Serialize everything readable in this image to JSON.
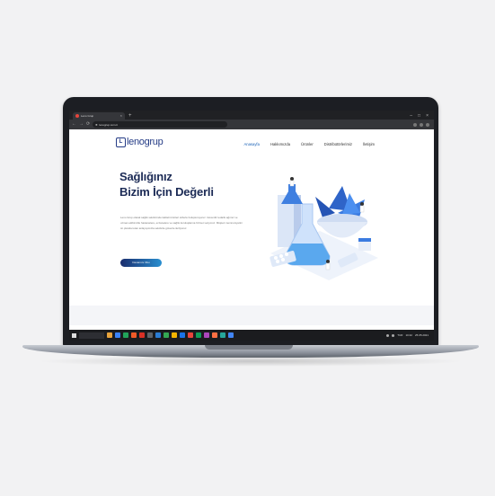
{
  "browser": {
    "tab_title": "Leno Grup",
    "url": "lenogrup.com.tr",
    "new_tab_glyph": "+",
    "close_glyph": "×",
    "window_controls": [
      "–",
      "□",
      "×"
    ],
    "nav_glyphs": [
      "←",
      "→",
      "⟳"
    ]
  },
  "site": {
    "logo_text": "lenogrup",
    "logo_mark": "L",
    "brand_color": "#253c86",
    "accent_color": "#2a8fd0",
    "menu": [
      {
        "label": "Anasayfa",
        "active": true
      },
      {
        "label": "Hakkımızda",
        "active": false
      },
      {
        "label": "Ürünler",
        "active": false
      },
      {
        "label": "Distribütörlerimiz",
        "active": false
      },
      {
        "label": "İletişim",
        "active": false
      }
    ],
    "hero": {
      "title_line1": "Sağlığınız",
      "title_line2": "Bizim İçin Değerli",
      "paragraph": "Leno Grup olarak sağlık sektöründe kaliteli ürünleri sizlerle buluşturuyoruz. Güvenilir tedarik ağımız ve uzman ekibimizle hastanelere, eczanelere ve sağlık kuruluşlarına hizmet veriyoruz. Müşteri memnuniyetini ön planda tutan anlayışımızla sektörde güvenle ilerliyoruz.",
      "button_label": "Devamını Oku"
    }
  },
  "taskbar": {
    "time": "10:42",
    "date": "25.05.2021",
    "language": "TUR",
    "icon_colors": [
      "#e8a33c",
      "#3b82f6",
      "#22a35a",
      "#f05a28",
      "#d93025",
      "#5f6368",
      "#2b7cd3",
      "#34a853",
      "#f4b400",
      "#1a73e8",
      "#e8453c",
      "#0f9d58",
      "#ab47bc",
      "#ff7043",
      "#26a69a",
      "#4285f4"
    ]
  }
}
